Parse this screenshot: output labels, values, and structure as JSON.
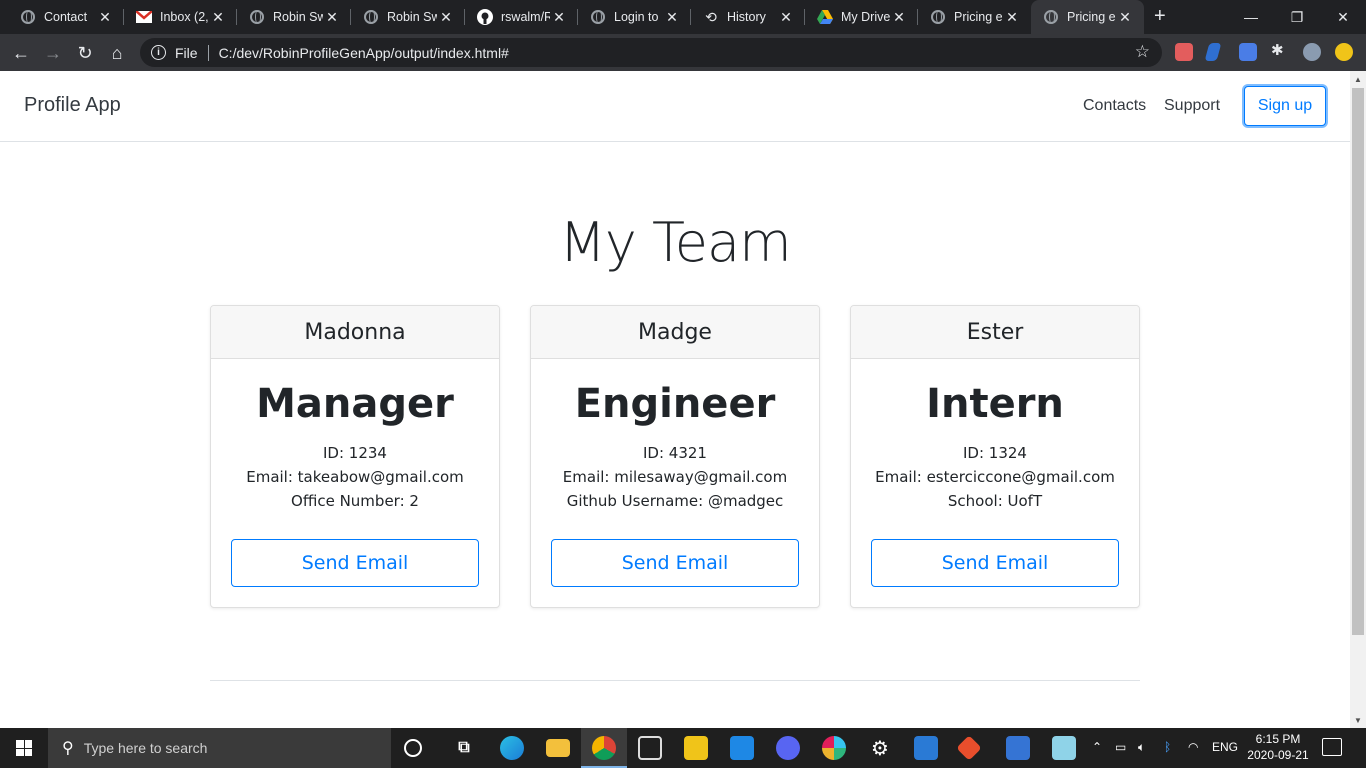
{
  "browser": {
    "tabs": [
      {
        "title": "Contact",
        "icon": "globe-icon"
      },
      {
        "title": "Inbox (2,",
        "icon": "gmail-icon"
      },
      {
        "title": "Robin Sw",
        "icon": "globe-icon"
      },
      {
        "title": "Robin Sw",
        "icon": "globe-icon"
      },
      {
        "title": "rswalm/R",
        "icon": "github-icon"
      },
      {
        "title": "Login to",
        "icon": "globe-icon"
      },
      {
        "title": "History",
        "icon": "history-icon"
      },
      {
        "title": "My Drive",
        "icon": "google-drive-icon"
      },
      {
        "title": "Pricing e",
        "icon": "globe-icon"
      },
      {
        "title": "Pricing e",
        "icon": "globe-icon",
        "active": true
      }
    ],
    "new_tab": "+",
    "address": {
      "scheme_label": "File",
      "url": "C:/dev/RobinProfileGenApp/output/index.html#"
    }
  },
  "page": {
    "brand": "Profile App",
    "nav": {
      "contacts": "Contacts",
      "support": "Support",
      "signup": "Sign up"
    },
    "heading": "My Team",
    "cards": [
      {
        "name": "Madonna",
        "role": "Manager",
        "id": "ID: 1234",
        "email": "Email: takeabow@gmail.com",
        "extra": "Office Number: 2",
        "button": "Send Email"
      },
      {
        "name": "Madge",
        "role": "Engineer",
        "id": "ID: 4321",
        "email": "Email: milesaway@gmail.com",
        "extra": "Github Username: @madgec",
        "button": "Send Email"
      },
      {
        "name": "Ester",
        "role": "Intern",
        "id": "ID: 1324",
        "email": "Email: esterciccone@gmail.com",
        "extra": "School: UofT",
        "button": "Send Email"
      }
    ]
  },
  "taskbar": {
    "search_placeholder": "Type here to search",
    "language": "ENG",
    "time": "6:15 PM",
    "date": "2020-09-21"
  },
  "colors": {
    "accent": "#007bff",
    "tabstrip": "#202124",
    "toolbar": "#35363a",
    "taskbar": "#1f1f1f"
  }
}
